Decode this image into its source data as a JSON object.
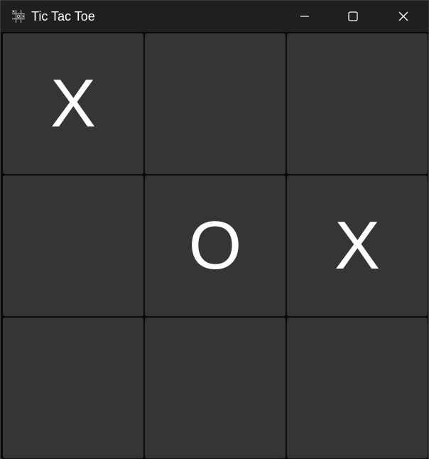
{
  "window": {
    "title": "Tic Tac Toe",
    "icon": "tic-tac-toe-grid-icon",
    "controls": {
      "minimize_icon": "minimize-icon",
      "maximize_icon": "maximize-icon",
      "close_icon": "close-icon"
    }
  },
  "board": {
    "cells": [
      "X",
      "",
      "",
      "",
      "O",
      "X",
      "",
      "",
      ""
    ]
  },
  "colors": {
    "titlebar": "#1f1f1f",
    "cell": "#353535",
    "grid_line": "#0a0a0a",
    "mark": "#ffffff"
  }
}
